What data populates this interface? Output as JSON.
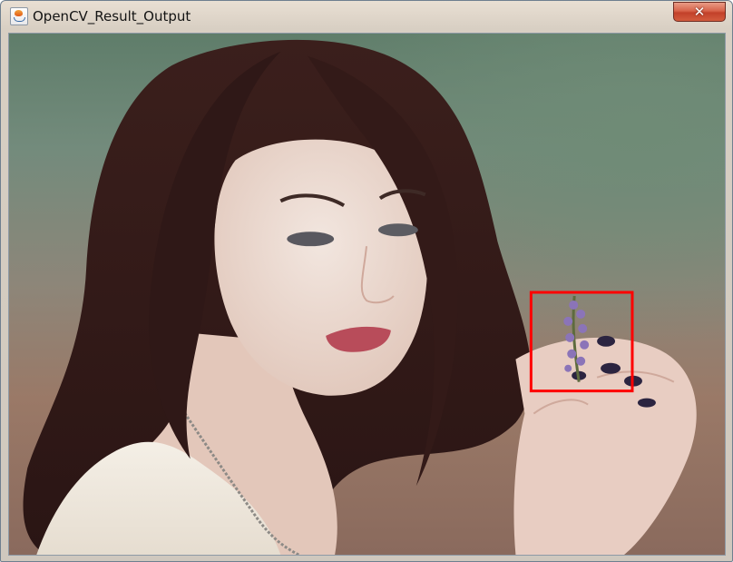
{
  "window": {
    "title": "OpenCV_Result_Output",
    "icon": "java-coffee-cup-icon",
    "close_icon": "close-icon",
    "close_glyph": "✕"
  },
  "image": {
    "detection_box_color": "#ff0000"
  }
}
